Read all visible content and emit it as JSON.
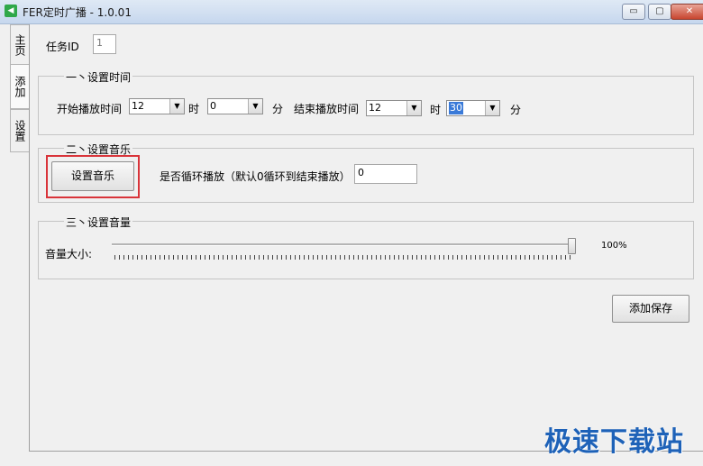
{
  "window": {
    "title": "FER定时广播 - 1.0.01",
    "minimize": "▭",
    "maximize": "▢",
    "close": "✕"
  },
  "tabs": [
    {
      "label": "主页"
    },
    {
      "label": "添加"
    },
    {
      "label": "设置"
    }
  ],
  "task": {
    "label": "任务ID",
    "value": "1"
  },
  "time_group": {
    "title": "一丶设置时间",
    "start_label": "开始播放时间",
    "start_hour": "12",
    "hour_unit": "时",
    "start_minute": "0",
    "minute_unit": "分",
    "end_label": "结束播放时间",
    "end_hour": "12",
    "end_minute": "30"
  },
  "music_group": {
    "title": "二丶设置音乐",
    "button_label": "设置音乐",
    "loop_label": "是否循环播放（默认0循环到结束播放）",
    "loop_value": "0"
  },
  "volume_group": {
    "title": "三丶设置音量",
    "label": "音量大小:",
    "value_text": "100%",
    "level": 1.0
  },
  "save_button": "添加保存",
  "watermark": "极速下载站",
  "colors": {
    "highlight_box": "#d9343a",
    "selection": "#3a7ad8",
    "watermark": "#1e62b8"
  }
}
